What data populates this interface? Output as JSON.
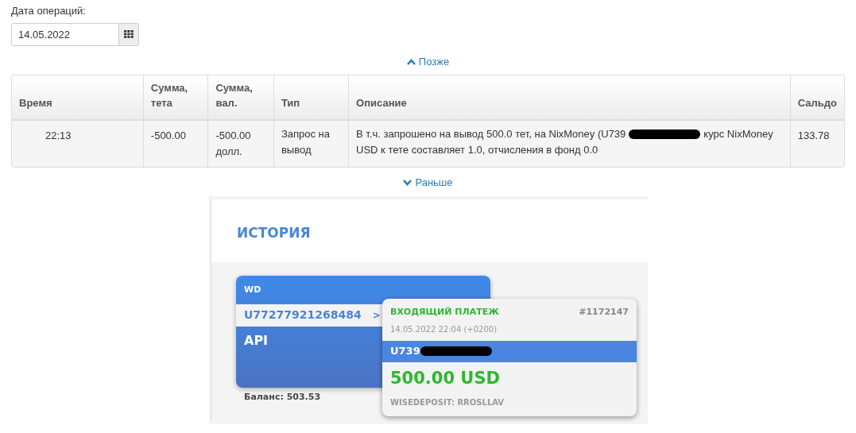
{
  "date_filter": {
    "label": "Дата операций:",
    "value": "14.05.2022"
  },
  "later_link": "Позже",
  "table": {
    "columns": [
      "Время",
      "Сумма, тета",
      "Сумма, вал.",
      "Тип",
      "Описание",
      "Сальдо"
    ],
    "rows": [
      {
        "time": "22:13",
        "amount": "-500.00",
        "amount_currency": "-500.00 долл.",
        "type": "Запрос на вывод",
        "description": [
          [
            {
              "kind": "text",
              "text": "В т.ч. запрошено на вывод 500.0 тет, на NixMoney (U739"
            },
            {
              "kind": "redacted"
            },
            {
              "kind": "text",
              "text": "курс NixMoney"
            }
          ],
          [
            {
              "kind": "text",
              "text": "USD к тете составляет 1.0, отчисления в фонд 0.0"
            }
          ]
        ],
        "balance": "133.78"
      }
    ]
  },
  "earlier_link": "Раньше",
  "embedded_screenshot": {
    "title": "ИСТОРИЯ",
    "wallet_card": {
      "label": "WD",
      "account": "U77277921268484",
      "arrow": ">",
      "name": "API",
      "balance": "Баланс: 503.53"
    },
    "payment_card": {
      "status": "ВХОДЯЩИЙ ПЛАТЕЖ",
      "number": "#1172147",
      "datetime": "14.05.2022 22:04 (+0200)",
      "account": [
        {
          "kind": "text",
          "text": "U739"
        },
        {
          "kind": "redacted"
        }
      ],
      "amount": "500.00 USD",
      "memo": "WISEDEPOSIT: RROSLLAV"
    }
  }
}
